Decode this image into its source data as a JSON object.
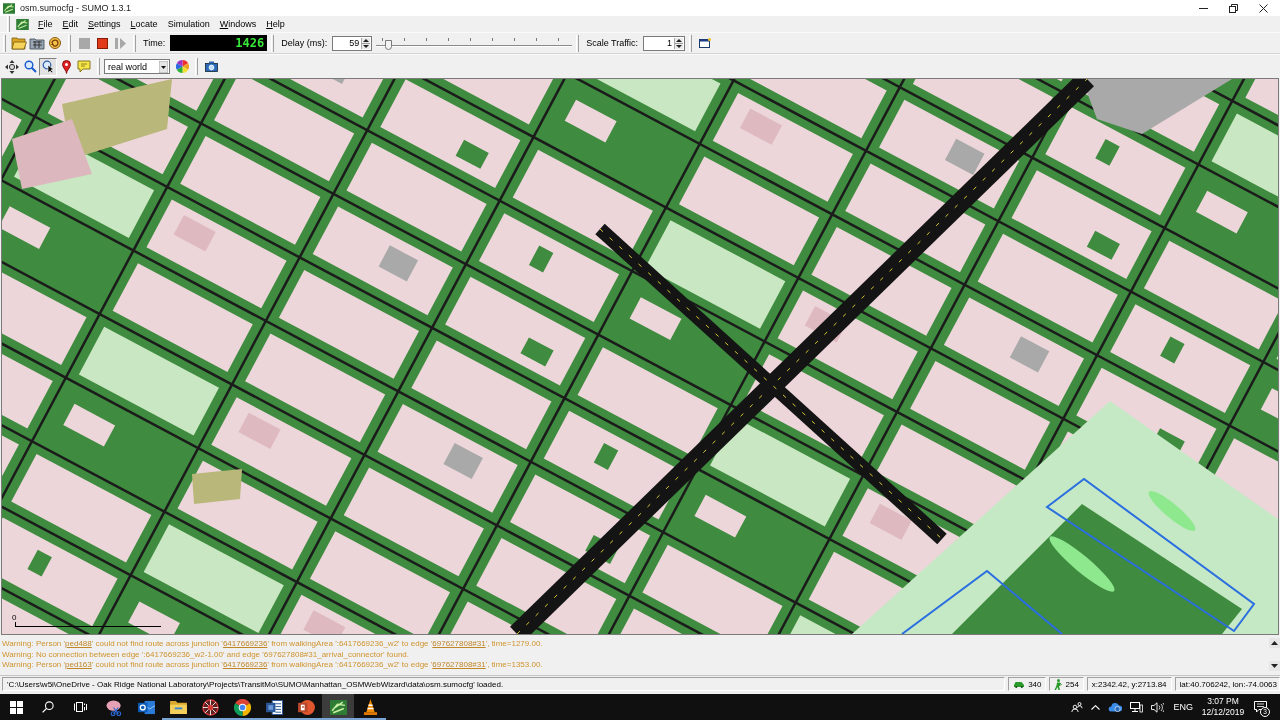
{
  "window": {
    "title": "osm.sumocfg - SUMO 1.3.1"
  },
  "menu": [
    {
      "label": "File",
      "mnemonic": true
    },
    {
      "label": "Edit",
      "mnemonic": true
    },
    {
      "label": "Settings",
      "mnemonic": true
    },
    {
      "label": "Locate",
      "mnemonic": true
    },
    {
      "label": "Simulation",
      "mnemonic": false
    },
    {
      "label": "Windows",
      "mnemonic": true
    },
    {
      "label": "Help",
      "mnemonic": true
    }
  ],
  "sim_controls": [
    {
      "kind": "run",
      "disabled": true
    },
    {
      "kind": "stop",
      "disabled": false
    },
    {
      "kind": "step",
      "disabled": true
    }
  ],
  "time": {
    "label": "Time:",
    "value": "1426"
  },
  "delay": {
    "label": "Delay (ms):",
    "value": "59",
    "level": 0.06
  },
  "scale_traffic": {
    "label": "Scale Traffic:",
    "value": "1"
  },
  "view_tools": [
    {
      "kind": "recenter",
      "pressed": false
    },
    {
      "kind": "zoom",
      "pressed": false
    },
    {
      "kind": "locate",
      "pressed": true
    },
    {
      "kind": "inspect",
      "pressed": false
    },
    {
      "kind": "tooltip",
      "pressed": false
    }
  ],
  "scheme": {
    "value": "real world"
  },
  "map": {
    "scale_label": "0"
  },
  "messages": [
    {
      "kind": "warning",
      "parts": [
        {
          "text": "Warning: Person '",
          "link": false
        },
        {
          "text": "ped488",
          "link": true
        },
        {
          "text": "' could not find route across junction '",
          "link": false
        },
        {
          "text": "6417669236",
          "link": true
        },
        {
          "text": "' from walkingArea ':6417669236_w2' to edge '",
          "link": false
        },
        {
          "text": "697627808#31",
          "link": true
        },
        {
          "text": "', time=1279.00.",
          "link": false
        }
      ]
    },
    {
      "kind": "warning",
      "parts": [
        {
          "text": "Warning: No connection between edge ':6417669236_w2-1.00' and edge '697627808#31_arrival_connector' found.",
          "link": false
        }
      ]
    },
    {
      "kind": "warning",
      "parts": [
        {
          "text": "Warning: Person '",
          "link": false
        },
        {
          "text": "ped163",
          "link": true
        },
        {
          "text": "' could not find route across junction '",
          "link": false
        },
        {
          "text": "6417669236",
          "link": true
        },
        {
          "text": "' from walkingArea ':6417669236_w2' to edge '",
          "link": false
        },
        {
          "text": "697627808#31",
          "link": true
        },
        {
          "text": "', time=1353.00.",
          "link": false
        }
      ]
    }
  ],
  "status_bar": {
    "message": "'C:\\Users\\w5i\\OneDrive - Oak Ridge National Laboratory\\Projects\\TransitMo\\SUMO\\Manhattan_OSMWebWizard\\data\\osm.sumocfg' loaded.",
    "vehicles": "340",
    "persons": "254",
    "position": "x:2342.42, y:2713.84",
    "geo": "lat:40.706242, lon:-74.0063"
  },
  "taskbar": {
    "apps": [
      {
        "kind": "snip",
        "open": false,
        "active": false
      },
      {
        "kind": "mail",
        "open": false,
        "active": false
      },
      {
        "kind": "folder",
        "open": true,
        "active": false
      },
      {
        "kind": "wheel",
        "open": true,
        "active": false
      },
      {
        "kind": "browser",
        "open": true,
        "active": false
      },
      {
        "kind": "document",
        "open": true,
        "active": false
      },
      {
        "kind": "slides",
        "open": true,
        "active": false
      },
      {
        "kind": "sumo",
        "open": true,
        "active": true
      },
      {
        "kind": "cone",
        "open": true,
        "active": false
      }
    ],
    "language": "ENG",
    "time": "3:07 PM",
    "date": "12/12/2019",
    "notifications": "3"
  }
}
